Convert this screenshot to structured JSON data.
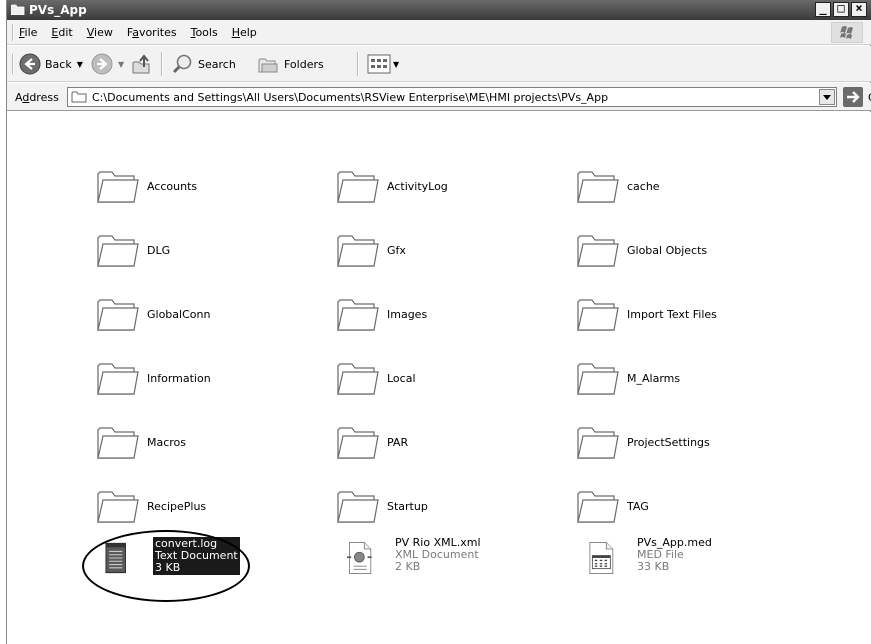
{
  "window": {
    "title": "PVs_App"
  },
  "menu": [
    {
      "label_u": "F",
      "label_rest": "ile"
    },
    {
      "label_u": "E",
      "label_rest": "dit"
    },
    {
      "label_u": "V",
      "label_rest": "iew"
    },
    {
      "label_pre": "F",
      "label_u": "a",
      "label_rest": "vorites"
    },
    {
      "label_u": "T",
      "label_rest": "ools"
    },
    {
      "label_u": "H",
      "label_rest": "elp"
    }
  ],
  "toolbar": {
    "back_label": "Back",
    "search_label": "Search",
    "folders_label": "Folders"
  },
  "address": {
    "label_pre": "A",
    "label_u": "d",
    "label_rest": "dress",
    "path": "C:\\Documents and Settings\\All Users\\Documents\\RSView Enterprise\\ME\\HMI projects\\PVs_App",
    "go_label": "Go"
  },
  "folders": [
    "Accounts",
    "ActivityLog",
    "cache",
    "DLG",
    "Gfx",
    "Global Objects",
    "GlobalConn",
    "Images",
    "Import Text Files",
    "Information",
    "Local",
    "M_Alarms",
    "Macros",
    "PAR",
    "ProjectSettings",
    "RecipePlus",
    "Startup",
    "TAG"
  ],
  "files": [
    {
      "name": "convert.log",
      "type": "Text Document",
      "size": "3 KB",
      "icon": "notepad-icon",
      "selected": true
    },
    {
      "name": "PV Rio XML.xml",
      "type": "XML Document",
      "size": "2 KB",
      "icon": "xml-document-icon",
      "selected": false
    },
    {
      "name": "PVs_App.med",
      "type": "MED File",
      "size": "33 KB",
      "icon": "med-file-icon",
      "selected": false
    }
  ]
}
